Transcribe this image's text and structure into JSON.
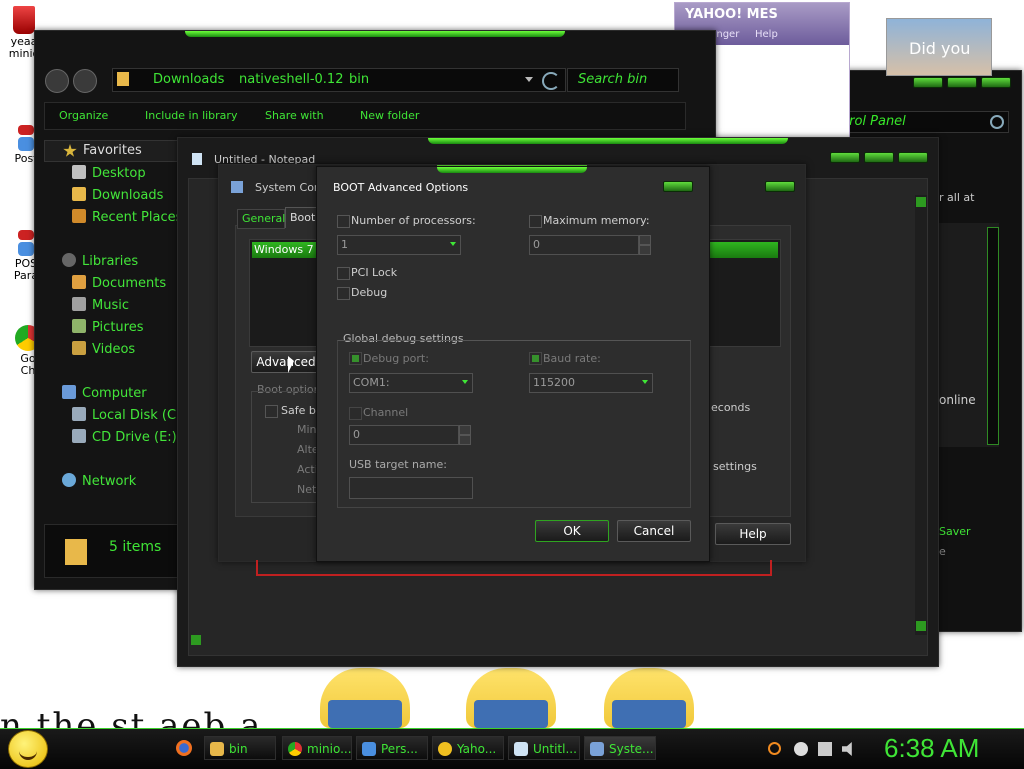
{
  "desktop": {
    "icons": [
      {
        "name": "recycle-bin",
        "label": "yeaa\nminio"
      },
      {
        "name": "post",
        "label": "Post"
      },
      {
        "name": "pos",
        "label": "POS\nPara"
      },
      {
        "name": "chrome",
        "label": "Go\nCh"
      }
    ],
    "handwriting": "n the st aeb a"
  },
  "explorer": {
    "address": [
      "Downloads",
      "nativeshell-0.12",
      "bin"
    ],
    "search_placeholder": "Search bin",
    "commands": [
      "Organize",
      "Include in library",
      "Share with",
      "New folder"
    ],
    "nav": {
      "favorites": "Favorites",
      "desktop": "Desktop",
      "downloads": "Downloads",
      "recent": "Recent Places",
      "libraries": "Libraries",
      "documents": "Documents",
      "music": "Music",
      "pictures": "Pictures",
      "videos": "Videos",
      "computer": "Computer",
      "local_disk": "Local Disk (C:",
      "cd_drive": "CD Drive (E:)",
      "network": "Network"
    },
    "status": "5 items"
  },
  "yahoo": {
    "logo": "YAHOO! MES",
    "menu": [
      "Messenger",
      "Help"
    ]
  },
  "avatar_text": "Did you",
  "control_panel": {
    "title": "trol Panel",
    "lines": [
      "r all at",
      "online",
      "Saver",
      "e"
    ]
  },
  "notepad": {
    "title": "Untitled - Notepad"
  },
  "sysconfig": {
    "title": "System Con",
    "tabs": [
      "General",
      "Boot"
    ],
    "list_item": "Windows 7 (",
    "advanced_button": "Advanced",
    "boot_options": "Boot options",
    "safe_boot": "Safe bo",
    "radios": [
      "Mini",
      "Alte",
      "Acti",
      "Net"
    ],
    "seconds": "econds",
    "settings": "settings",
    "help_button": "Help"
  },
  "boot_dialog": {
    "title": "BOOT Advanced Options",
    "num_processors_label": "Number of processors:",
    "num_processors_value": "1",
    "max_memory_label": "Maximum memory:",
    "max_memory_value": "0",
    "pci_lock": "PCI Lock",
    "debug": "Debug",
    "global_debug": "Global debug settings",
    "debug_port_label": "Debug port:",
    "debug_port_value": "COM1:",
    "baud_rate_label": "Baud rate:",
    "baud_rate_value": "115200",
    "channel_label": "Channel",
    "channel_value": "0",
    "usb_label": "USB target name:",
    "usb_value": "",
    "ok": "OK",
    "cancel": "Cancel"
  },
  "taskbar": {
    "items": [
      {
        "label": "bin",
        "icon": "folder-icon"
      },
      {
        "label": "minio...",
        "icon": "chrome-icon"
      },
      {
        "label": "Pers...",
        "icon": "monitor-icon"
      },
      {
        "label": "Yaho...",
        "icon": "yahoo-icon"
      },
      {
        "label": "Untitl...",
        "icon": "notepad-icon"
      },
      {
        "label": "Syste...",
        "icon": "sysconfig-icon"
      }
    ],
    "clock": "6:38 AM"
  },
  "colors": {
    "accent": "#3fe536",
    "bg": "#141414"
  }
}
